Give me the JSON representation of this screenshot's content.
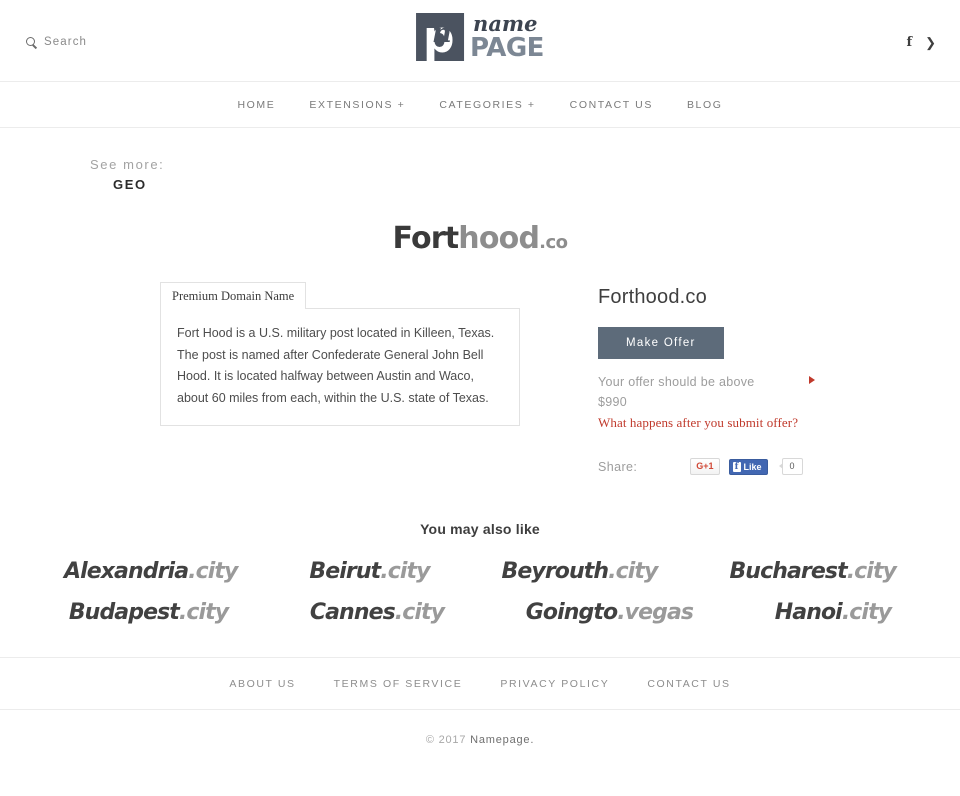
{
  "header": {
    "search": {
      "label": "Search",
      "icon": "search-icon"
    },
    "logo": {
      "mark_p": "p",
      "mark_n": "n",
      "word_script": "name",
      "word_bold": "PAGE"
    },
    "social": [
      {
        "name": "facebook-icon",
        "glyph": "f"
      },
      {
        "name": "twitter-icon",
        "glyph": "❯"
      }
    ]
  },
  "nav": {
    "items": [
      {
        "label": "HOME"
      },
      {
        "label": "EXTENSIONS +"
      },
      {
        "label": "CATEGORIES +"
      },
      {
        "label": "CONTACT US"
      },
      {
        "label": "BLOG"
      }
    ]
  },
  "see_more": {
    "label": "See more:",
    "tag": "GEO"
  },
  "hero": {
    "part_dark": "Fort",
    "part_light": "hood",
    "tld": ".co"
  },
  "info_panel": {
    "tab_label": "Premium Domain Name",
    "body": "Fort Hood is a U.S. military post located in Killeen, Texas. The post is named after Confederate General John Bell Hood. It is located halfway between Austin and Waco, about 60 miles from each, within the U.S. state of Texas."
  },
  "offer_panel": {
    "title": "Forthood.co",
    "button_label": "Make Offer",
    "note_line1": "Your offer should be above",
    "note_line2": "$990",
    "link_label": "What happens after you submit offer?",
    "arrow_color": "#c0392b",
    "button_color": "#5d6b7a"
  },
  "share": {
    "label": "Share:",
    "gplus_label": "G+1",
    "facebook_label": "Like",
    "facebook_badge": "f",
    "count": "0"
  },
  "also_like": {
    "title": "You may also like",
    "rows": [
      [
        {
          "name": "Alexandria",
          "tld": ".city"
        },
        {
          "name": "Beirut",
          "tld": ".city"
        },
        {
          "name": "Beyrouth",
          "tld": ".city"
        },
        {
          "name": "Bucharest",
          "tld": ".city"
        }
      ],
      [
        {
          "name": "Budapest",
          "tld": ".city"
        },
        {
          "name": "Cannes",
          "tld": ".city"
        },
        {
          "name": "Goingto",
          "tld": ".vegas"
        },
        {
          "name": "Hanoi",
          "tld": ".city"
        }
      ]
    ]
  },
  "footer": {
    "links": [
      {
        "label": "ABOUT US"
      },
      {
        "label": "TERMS OF SERVICE"
      },
      {
        "label": "PRIVACY POLICY"
      },
      {
        "label": "CONTACT US"
      }
    ],
    "copyright_prefix": "© 2017 ",
    "copyright_brand": "Namepage."
  }
}
